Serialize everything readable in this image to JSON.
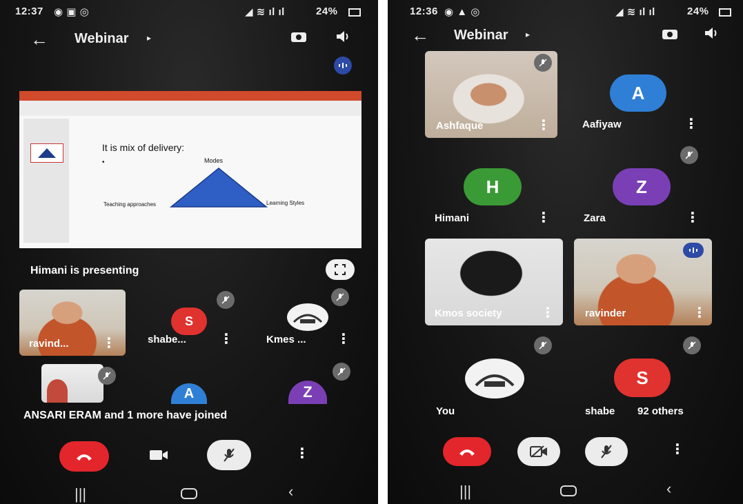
{
  "left": {
    "status": {
      "time": "12:37",
      "battery": "24%"
    },
    "header": {
      "title": "Webinar"
    },
    "slide": {
      "heading": "It is mix of delivery:",
      "label_top": "Modes",
      "label_left": "Teaching approaches",
      "label_right": "Learning Styles"
    },
    "presenting_text": "Himani is presenting",
    "participants": [
      {
        "name": "ravind...",
        "type": "video"
      },
      {
        "name": "shabe...",
        "initial": "S",
        "color": "#e0322f"
      },
      {
        "name": "Kmes ...",
        "type": "logo"
      }
    ],
    "row2_avatars": [
      {
        "initial": "A",
        "color": "#2f7fd6"
      },
      {
        "initial": "Z",
        "color": "#7a3fb5"
      }
    ],
    "toast": "ANSARI ERAM and 1 more have joined"
  },
  "right": {
    "status": {
      "time": "12:36",
      "battery": "24%"
    },
    "header": {
      "title": "Webinar"
    },
    "tiles": [
      {
        "name": "Ashfaque",
        "type": "video"
      },
      {
        "name": "Aafiyaw",
        "initial": "A",
        "color": "#2f7fd6"
      },
      {
        "name": "Himani",
        "initial": "H",
        "color": "#3a9a35"
      },
      {
        "name": "Zara",
        "initial": "Z",
        "color": "#7a3fb5"
      },
      {
        "name": "Kmos society",
        "type": "video"
      },
      {
        "name": "ravinder",
        "type": "video"
      },
      {
        "name": "You",
        "type": "logo"
      },
      {
        "name": "shabe",
        "initial": "S",
        "color": "#e0322f"
      }
    ],
    "others_text": "92 others"
  },
  "colors": {
    "end_call": "#e3262b",
    "control_light": "#ececec"
  }
}
